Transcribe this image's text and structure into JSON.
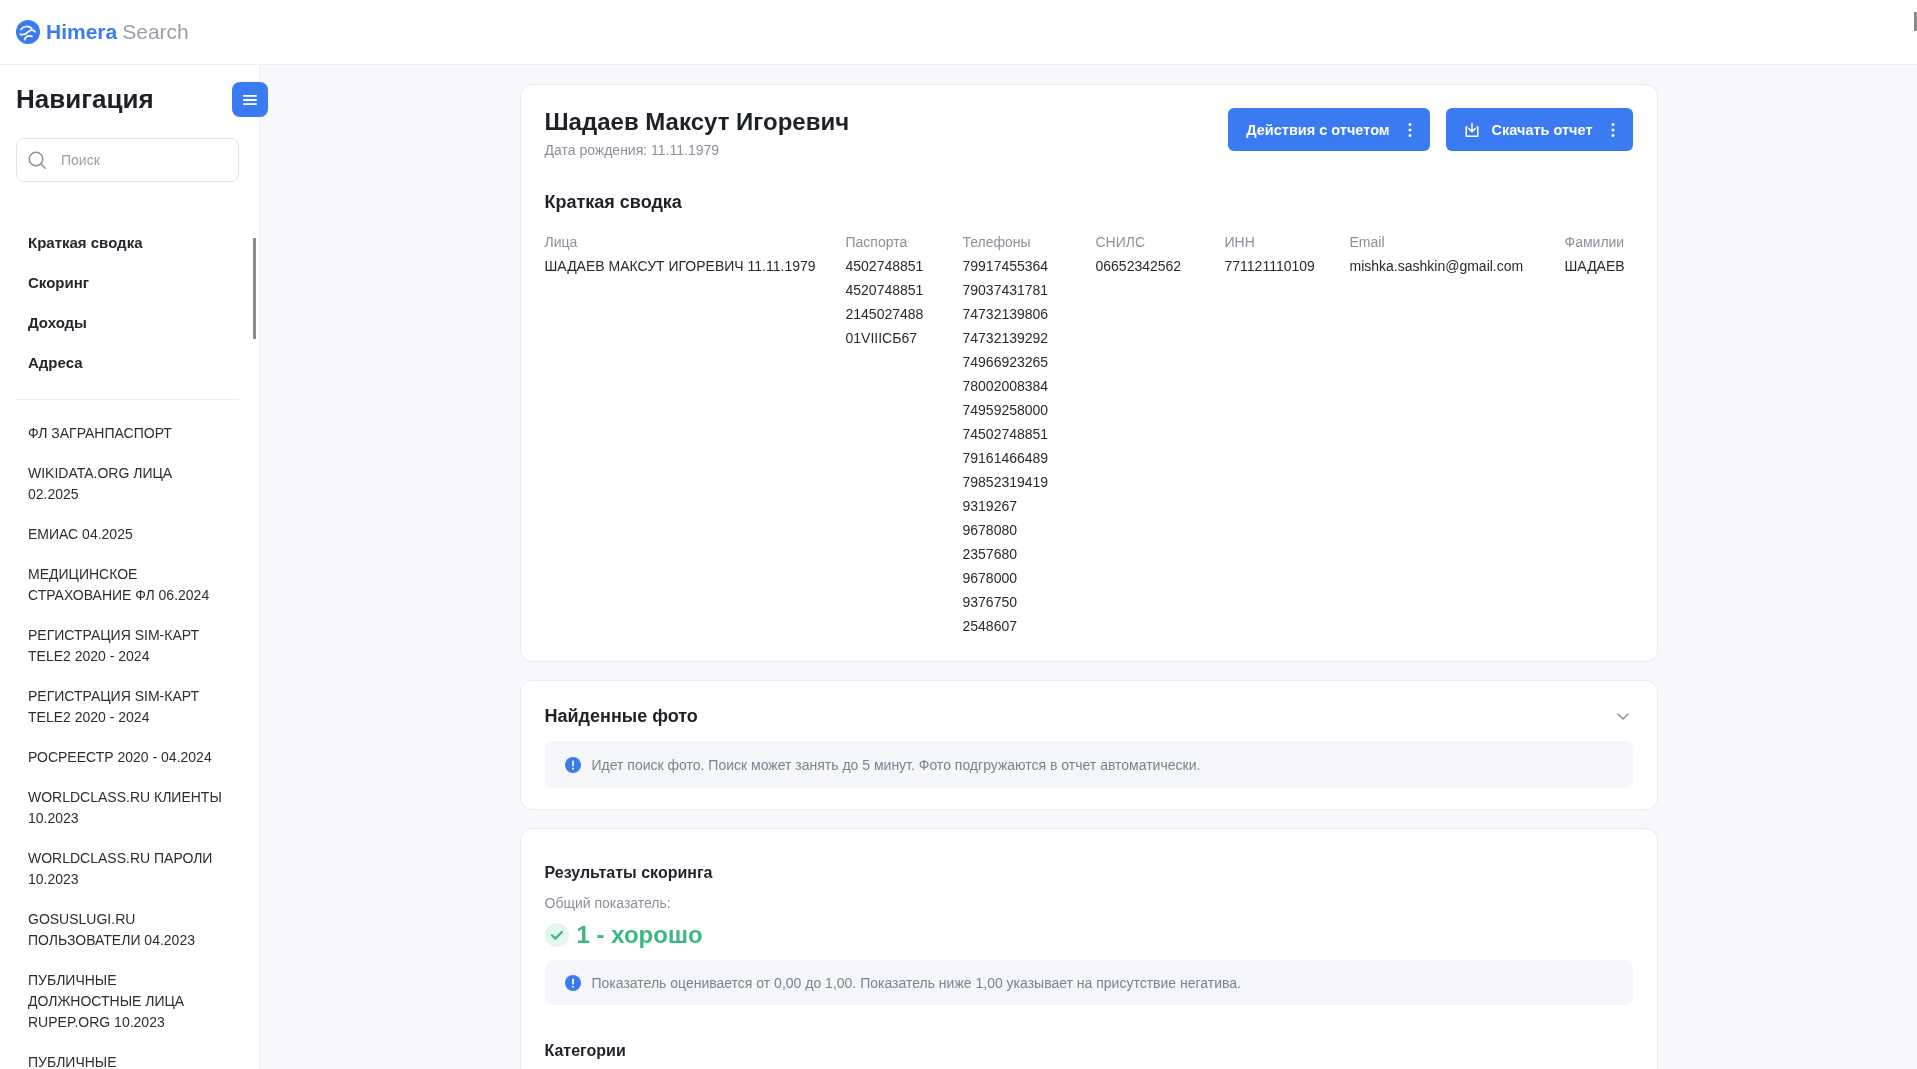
{
  "header": {
    "brand": "Himera",
    "product": "Search"
  },
  "sidebar": {
    "title": "Навигация",
    "search": {
      "placeholder": "Поиск"
    },
    "sections": [
      "Краткая сводка",
      "Скоринг",
      "Доходы",
      "Адреса"
    ],
    "sources": [
      "ФЛ ЗАГРАНПАСПОРТ",
      "WIKIDATA.ORG ЛИЦА 02.2025",
      "ЕМИАС 04.2025",
      "МЕДИЦИНСКОЕ СТРАХОВАНИЕ ФЛ 06.2024",
      "РЕГИСТРАЦИЯ SIM-КАРТ TELE2 2020 - 2024",
      "РЕГИСТРАЦИЯ SIM-КАРТ TELE2 2020 - 2024",
      "РОСРЕЕСТР 2020 - 04.2024",
      "WORLDCLASS.RU КЛИЕНТЫ 10.2023",
      "WORLDCLASS.RU ПАРОЛИ 10.2023",
      "GOSUSLUGI.RU ПОЛЬЗОВАТЕЛИ 04.2023",
      "ПУБЛИЧНЫЕ ДОЛЖНОСТНЫЕ ЛИЦА RUPEP.ORG 10.2023",
      "ПУБЛИЧНЫЕ"
    ]
  },
  "report": {
    "name": "Шадаев Максут Игоревич",
    "birth_date": "Дата рождения: 11.11.1979",
    "buttons": [
      {
        "kind": "actions",
        "label": "Действия с отчетом"
      },
      {
        "kind": "download",
        "label": "Скачать отчет"
      }
    ]
  },
  "summary": {
    "title": "Краткая сводка",
    "columns": [
      {
        "header": "Лица",
        "values": [
          "ШАДАЕВ МАКСУТ ИГОРЕВИЧ 11.11.1979"
        ]
      },
      {
        "header": "Паспорта",
        "values": [
          "4502748851",
          "4520748851",
          "2145027488",
          "01VIIIСБ67"
        ]
      },
      {
        "header": "Телефоны",
        "values": [
          "79917455364",
          "79037431781",
          "74732139806",
          "74732139292",
          "74966923265",
          "78002008384",
          "74959258000",
          "74502748851",
          "79161466489",
          "79852319419",
          "9319267",
          "9678080",
          "2357680",
          "9678000",
          "9376750",
          "2548607"
        ]
      },
      {
        "header": "СНИЛС",
        "values": [
          "06652342562"
        ]
      },
      {
        "header": "ИНН",
        "values": [
          "771121110109"
        ]
      },
      {
        "header": "Email",
        "values": [
          "mishka.sashkin@gmail.com"
        ]
      },
      {
        "header": "Фамилии",
        "values": [
          "ШАДАЕВ"
        ]
      }
    ]
  },
  "photos": {
    "title": "Найденные фото",
    "notice": "Идет поиск фото. Поиск может занять до 5 минут. Фото подгружаются в отчет автоматически."
  },
  "scoring": {
    "title": "Результаты скоринга",
    "label": "Общий показатель:",
    "result": "1 - хорошо",
    "notice": "Показатель оценивается от 0,00 до 1,00. Показатель ниже 1,00 указывает на присутствие негатива.",
    "categories_title": "Категории"
  }
}
